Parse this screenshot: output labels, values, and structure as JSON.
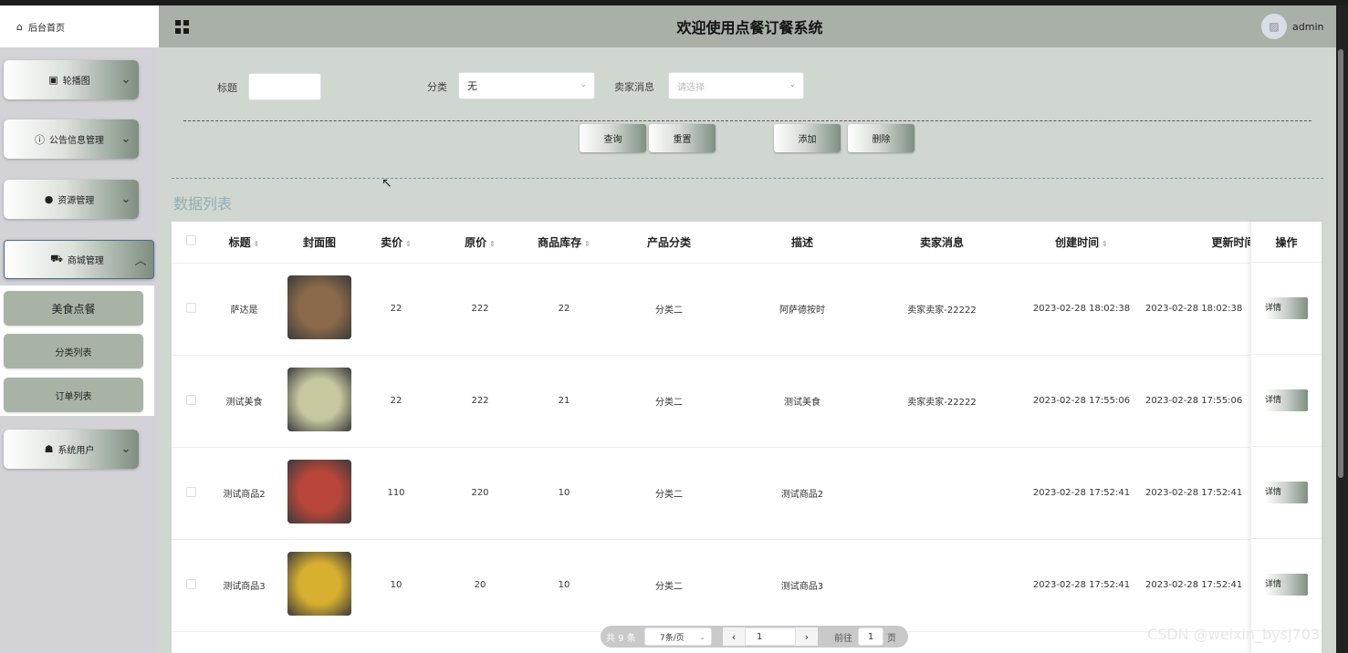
{
  "sidebar": {
    "home": "后台首页",
    "menus": [
      {
        "label": "轮播图",
        "icon": "image-icon"
      },
      {
        "label": "公告信息管理",
        "icon": "info-icon"
      },
      {
        "label": "资源管理",
        "icon": "bulb-icon"
      },
      {
        "label": "商城管理",
        "icon": "cart-icon"
      },
      {
        "label": "系统用户",
        "icon": "user-icon"
      }
    ],
    "submenu": [
      "美食点餐",
      "分类列表",
      "订单列表"
    ]
  },
  "header": {
    "title": "欢迎使用点餐订餐系统",
    "user": "admin"
  },
  "search": {
    "title_label": "标题",
    "title_value": "",
    "category_label": "分类",
    "category_value": "无",
    "seller_label": "卖家消息",
    "seller_placeholder": "请选择"
  },
  "actions": {
    "query": "查询",
    "reset": "重置",
    "add": "添加",
    "delete": "删除"
  },
  "section_title": "数据列表",
  "table": {
    "headers": [
      "标题",
      "封面图",
      "卖价",
      "原价",
      "商品库存",
      "产品分类",
      "描述",
      "卖家消息",
      "创建时间",
      "更新时间",
      "操作"
    ],
    "rows": [
      {
        "title": "萨达是",
        "price": "22",
        "orig": "222",
        "stock": "22",
        "cat": "分类二",
        "desc": "阿萨德按时",
        "seller": "卖家卖家-22222",
        "created": "2023-02-28 18:02:38",
        "updated": "2023-02-28 18:02:38",
        "img": "#8a6a4a"
      },
      {
        "title": "测试美食",
        "price": "22",
        "orig": "222",
        "stock": "21",
        "cat": "分类二",
        "desc": "测试美食",
        "seller": "卖家卖家-22222",
        "created": "2023-02-28 17:55:06",
        "updated": "2023-02-28 17:55:06",
        "img": "#c8c8a0"
      },
      {
        "title": "测试商品2",
        "price": "110",
        "orig": "220",
        "stock": "10",
        "cat": "分类二",
        "desc": "测试商品2",
        "seller": "",
        "created": "2023-02-28 17:52:41",
        "updated": "2023-02-28 17:52:41",
        "img": "#b8463a"
      },
      {
        "title": "测试商品3",
        "price": "10",
        "orig": "20",
        "stock": "10",
        "cat": "分类二",
        "desc": "测试商品3",
        "seller": "",
        "created": "2023-02-28 17:52:41",
        "updated": "2023-02-28 17:52:41",
        "img": "#d8b030"
      }
    ],
    "detail_label": "详情"
  },
  "pager": {
    "total": "共 9 条",
    "size": "7条/页",
    "page": "1",
    "goto": "前往",
    "goto_value": "1",
    "unit": "页"
  },
  "watermark": "CSDN @weixin_bysj703"
}
